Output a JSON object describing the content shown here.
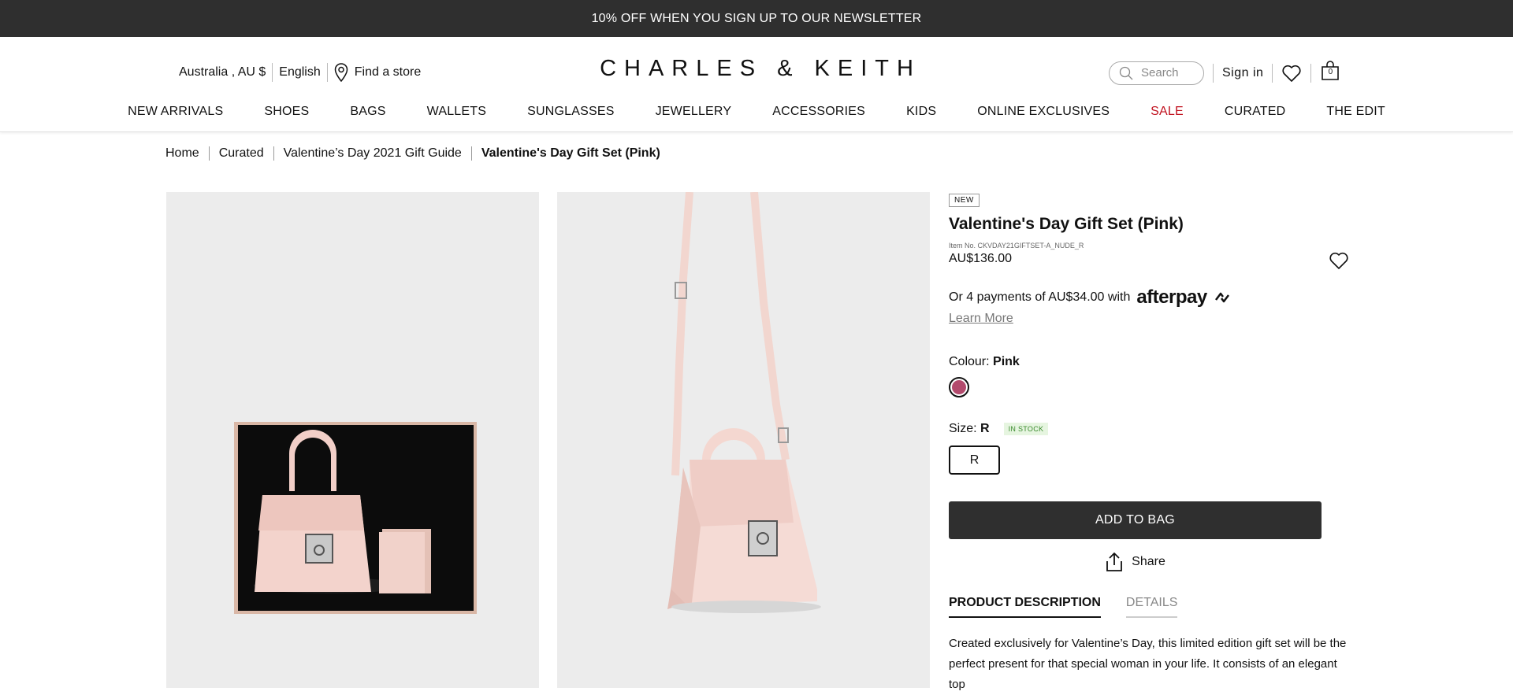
{
  "promo": "10% OFF WHEN YOU SIGN UP TO OUR NEWSLETTER",
  "header": {
    "region": "Australia , AU $",
    "language": "English",
    "find_store": "Find a store",
    "logo": "CHARLES & KEITH",
    "search_placeholder": "Search",
    "sign_in": "Sign in",
    "bag_count": "0"
  },
  "nav": [
    "NEW ARRIVALS",
    "SHOES",
    "BAGS",
    "WALLETS",
    "SUNGLASSES",
    "JEWELLERY",
    "ACCESSORIES",
    "KIDS",
    "ONLINE EXCLUSIVES",
    "SALE",
    "CURATED",
    "THE EDIT"
  ],
  "breadcrumb": [
    "Home",
    "Curated",
    "Valentine’s Day 2021 Gift Guide",
    "Valentine's Day Gift Set (Pink)"
  ],
  "product": {
    "badge": "NEW",
    "title": "Valentine's Day Gift Set (Pink)",
    "item_no": "Item No. CKVDAY21GIFTSET-A_NUDE_R",
    "price": "AU$136.00",
    "afterpay_text": "Or 4 payments of AU$34.00 with",
    "afterpay_logo": "afterpay",
    "learn_more": "Learn More",
    "colour_label": "Colour:",
    "colour_value": "Pink",
    "swatch_color": "#b34a6d",
    "size_label": "Size:",
    "size_value": "R",
    "stock": "IN STOCK",
    "size_option": "R",
    "add_to_bag": "ADD TO BAG",
    "share": "Share",
    "tab_description": "PRODUCT DESCRIPTION",
    "tab_details": "DETAILS",
    "description": "Created exclusively for Valentine’s Day, this limited edition gift set will be the perfect present for that special woman in your life. It consists of an elegant top"
  }
}
